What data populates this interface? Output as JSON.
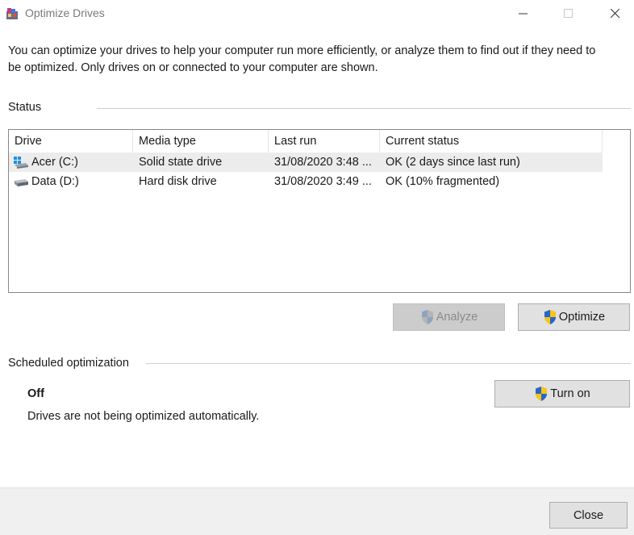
{
  "window": {
    "title": "Optimize Drives"
  },
  "intro": "You can optimize your drives to help your computer run more efficiently, or analyze them to find out if they need to be optimized. Only drives on or connected to your computer are shown.",
  "status": {
    "label": "Status",
    "columns": [
      "Drive",
      "Media type",
      "Last run",
      "Current status"
    ],
    "drives": [
      {
        "name": "Acer (C:)",
        "media_type": "Solid state drive",
        "last_run": "31/08/2020 3:48 ...",
        "status": "OK (2 days since last run)",
        "icon": "windows-drive-icon",
        "selected": true
      },
      {
        "name": "Data (D:)",
        "media_type": "Hard disk drive",
        "last_run": "31/08/2020 3:49 ...",
        "status": "OK (10% fragmented)",
        "icon": "hard-drive-icon",
        "selected": false
      }
    ],
    "analyze_label": "Analyze",
    "optimize_label": "Optimize"
  },
  "scheduled": {
    "label": "Scheduled optimization",
    "state": "Off",
    "description": "Drives are not being optimized automatically.",
    "turn_on_label": "Turn on"
  },
  "footer": {
    "close_label": "Close"
  },
  "colors": {
    "shield_blue": "#2a65c9",
    "shield_yellow": "#f5c518",
    "button_bg": "#e1e1e1",
    "footer_bg": "#f0f0f0"
  }
}
